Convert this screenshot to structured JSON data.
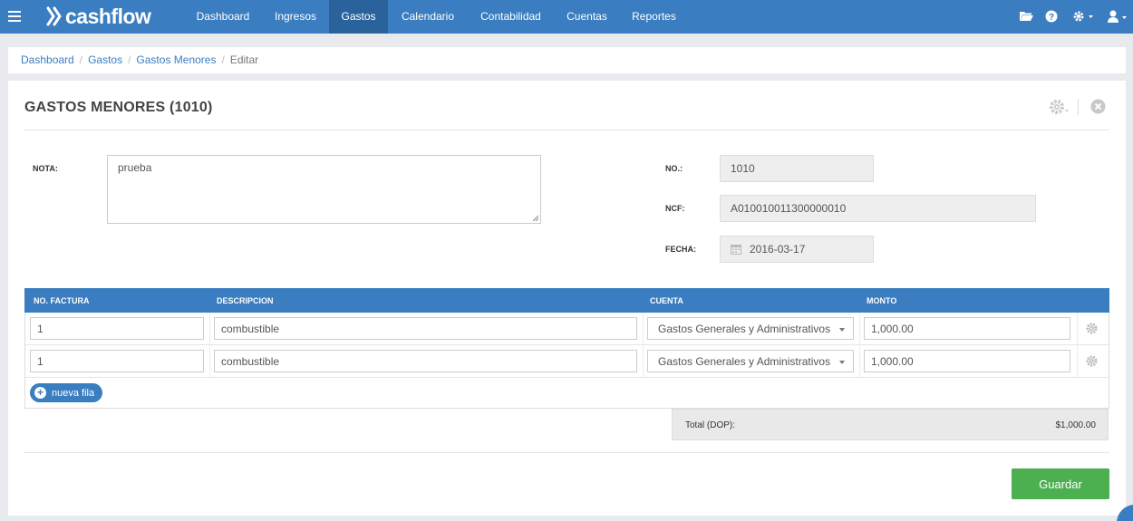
{
  "brand": {
    "name": "cashflow"
  },
  "nav": {
    "items": [
      {
        "label": "Dashboard"
      },
      {
        "label": "Ingresos"
      },
      {
        "label": "Gastos"
      },
      {
        "label": "Calendario"
      },
      {
        "label": "Contabilidad"
      },
      {
        "label": "Cuentas"
      },
      {
        "label": "Reportes"
      }
    ],
    "active": "Gastos"
  },
  "breadcrumb": {
    "items": [
      {
        "label": "Dashboard"
      },
      {
        "label": "Gastos"
      },
      {
        "label": "Gastos Menores"
      }
    ],
    "current": "Editar"
  },
  "page": {
    "title": "GASTOS MENORES (1010)"
  },
  "form": {
    "nota_label": "NOTA:",
    "nota_value": "prueba",
    "no_label": "NO.:",
    "no_value": "1010",
    "ncf_label": "NCF:",
    "ncf_value": "A010010011300000010",
    "fecha_label": "FECHA:",
    "fecha_value": "2016-03-17"
  },
  "table": {
    "headers": {
      "factura": "NO. FACTURA",
      "descripcion": "DESCRIPCION",
      "cuenta": "CUENTA",
      "monto": "MONTO"
    },
    "rows": [
      {
        "factura": "1",
        "descripcion": "combustible",
        "cuenta": "Gastos Generales y Administrativos",
        "monto": "1,000.00"
      },
      {
        "factura": "1",
        "descripcion": "combustible",
        "cuenta": "Gastos Generales y Administrativos",
        "monto": "1,000.00"
      }
    ],
    "add_label": "nueva fila"
  },
  "totals": {
    "label": "Total (DOP):",
    "value": "$1,000.00"
  },
  "actions": {
    "save_label": "Guardar"
  },
  "colors": {
    "primary": "#3a7dc0",
    "active_nav": "#2a639c",
    "save": "#4caf50"
  }
}
